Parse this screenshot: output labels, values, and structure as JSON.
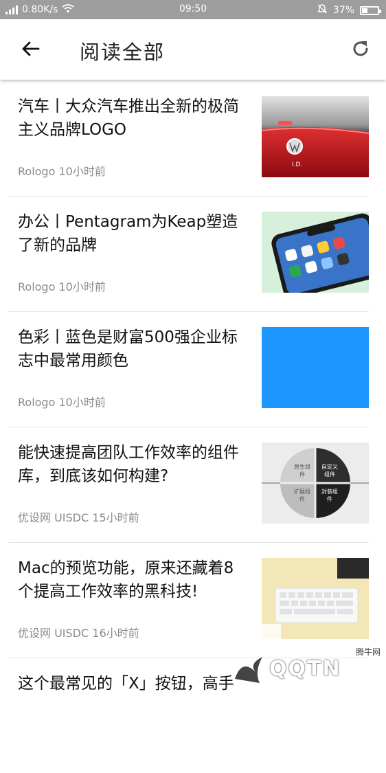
{
  "status_bar": {
    "network_speed": "0.80K/s",
    "time": "09:50",
    "battery": "37%",
    "battery_level": 0.37
  },
  "header": {
    "title": "阅读全部",
    "back_icon": "back-arrow-icon",
    "refresh_icon": "refresh-icon"
  },
  "articles": [
    {
      "title": "汽车丨大众汽车推出全新的极简主义品牌LOGO",
      "source": "Rologo",
      "time": "10小时前"
    },
    {
      "title": "办公丨Pentagram为Keap塑造了新的品牌",
      "source": "Rologo",
      "time": "10小时前"
    },
    {
      "title": "色彩丨蓝色是财富500强企业标志中最常用颜色",
      "source": "Rologo",
      "time": "10小时前"
    },
    {
      "title": "能快速提高团队工作效率的组件库，到底该如何构建?",
      "source": "优设网 UISDC",
      "time": "15小时前",
      "thumb_labels": [
        "原生组件",
        "自定义组件",
        "扩展组件",
        "封装组件"
      ]
    },
    {
      "title": "Mac的预览功能，原来还藏着8个提高工作效率的黑科技!",
      "source": "优设网 UISDC",
      "time": "16小时前"
    },
    {
      "title": "这个最常见的「X」按钮，高手",
      "source": "",
      "time": ""
    }
  ],
  "watermark": {
    "brand": "QQTN",
    "sub": "腾牛网"
  },
  "colors": {
    "status_bar": "#9d9d9d",
    "accent_blue": "#1e96ff",
    "car_red": "#c0121a"
  }
}
